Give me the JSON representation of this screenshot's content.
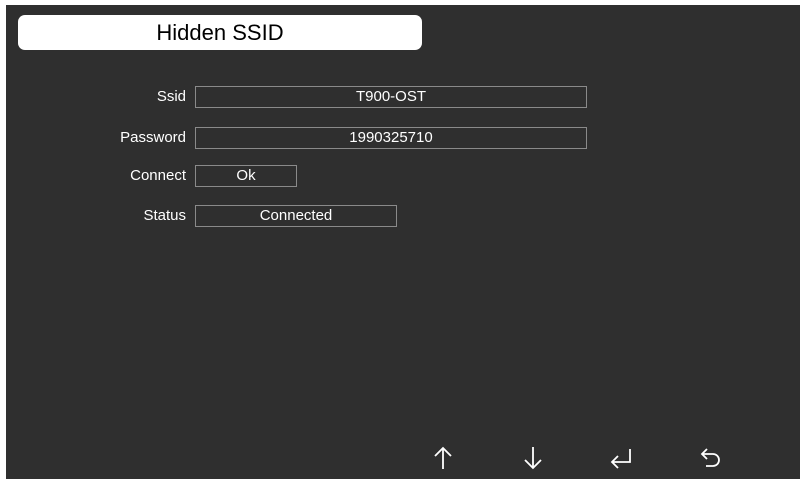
{
  "header": {
    "title": "Hidden SSID"
  },
  "form": {
    "ssid": {
      "label": "Ssid",
      "value": "T900-OST"
    },
    "password": {
      "label": "Password",
      "value": "1990325710"
    },
    "connect": {
      "label": "Connect",
      "button_label": "Ok"
    },
    "status": {
      "label": "Status",
      "value": "Connected"
    }
  },
  "nav": {
    "up": "arrow-up-icon",
    "down": "arrow-down-icon",
    "enter": "enter-return-icon",
    "back": "back-undo-icon"
  },
  "colors": {
    "background": "#2f2f2f",
    "title_bar": "#ffffff",
    "field_border": "#8a8a8a",
    "text": "#ffffff"
  }
}
